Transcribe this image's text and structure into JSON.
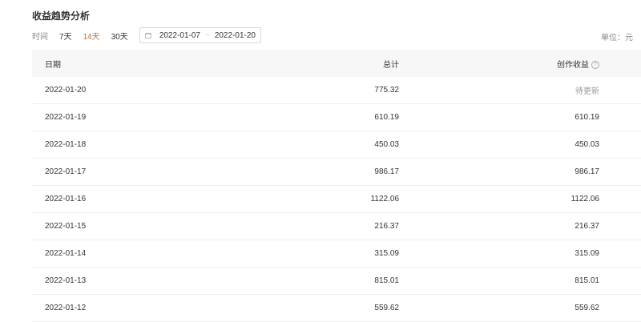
{
  "page": {
    "title": "收益趋势分析",
    "unit": "单位：元"
  },
  "filters": {
    "label": "时间",
    "ranges": [
      "7天",
      "14天",
      "30天"
    ],
    "active_range": "14天",
    "start_date": "2022-01-07",
    "separator": "~",
    "end_date": "2022-01-20"
  },
  "table": {
    "headers": {
      "date": "日期",
      "total": "总计",
      "income": "创作收益"
    },
    "rows": [
      {
        "date": "2022-01-20",
        "total": "775.32",
        "income": "待更新"
      },
      {
        "date": "2022-01-19",
        "total": "610.19",
        "income": "610.19"
      },
      {
        "date": "2022-01-18",
        "total": "450.03",
        "income": "450.03"
      },
      {
        "date": "2022-01-17",
        "total": "986.17",
        "income": "986.17"
      },
      {
        "date": "2022-01-16",
        "total": "1122.06",
        "income": "1122.06"
      },
      {
        "date": "2022-01-15",
        "total": "216.37",
        "income": "216.37"
      },
      {
        "date": "2022-01-14",
        "total": "315.09",
        "income": "315.09"
      },
      {
        "date": "2022-01-13",
        "total": "815.01",
        "income": "815.01"
      },
      {
        "date": "2022-01-12",
        "total": "559.62",
        "income": "559.62"
      }
    ]
  }
}
